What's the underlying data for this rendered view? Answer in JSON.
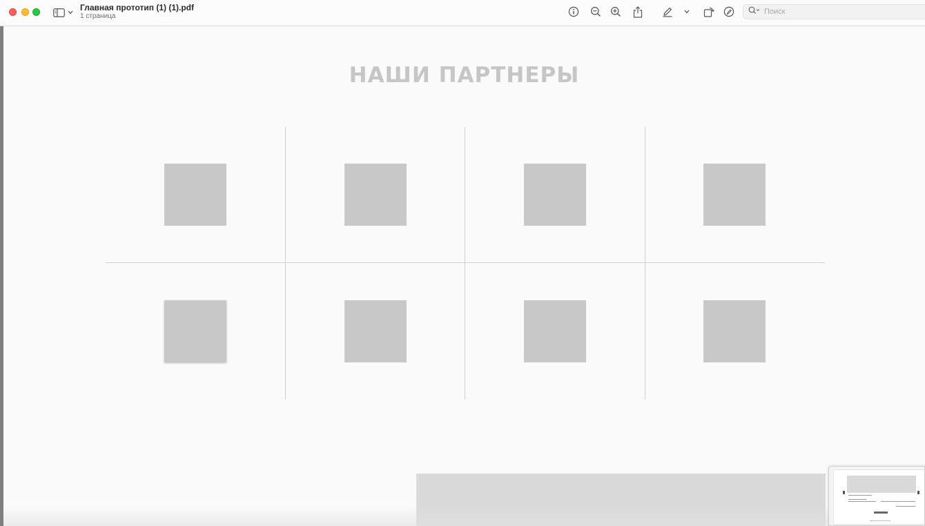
{
  "window": {
    "title": "Главная прототип (1) (1).pdf",
    "subtitle": "1 страница"
  },
  "toolbar": {
    "icons": [
      "info-icon",
      "zoom-out-icon",
      "zoom-in-icon",
      "share-icon",
      "markup-pen-icon",
      "chevron-down-icon",
      "rotate-icon",
      "annotate-icon"
    ],
    "search_placeholder": "Поиск"
  },
  "page": {
    "heading": "НАШИ ПАРТНЕРЫ",
    "partner_logos": 8,
    "colors": {
      "heading": "#c6c6c6",
      "logo_placeholder": "#c8c8c8",
      "grid_line": "#cfcfcf",
      "footer_block": "#dadada"
    }
  },
  "colors": {
    "close": "#ff5f57",
    "minimize": "#febc2e",
    "maximize": "#28c840"
  }
}
